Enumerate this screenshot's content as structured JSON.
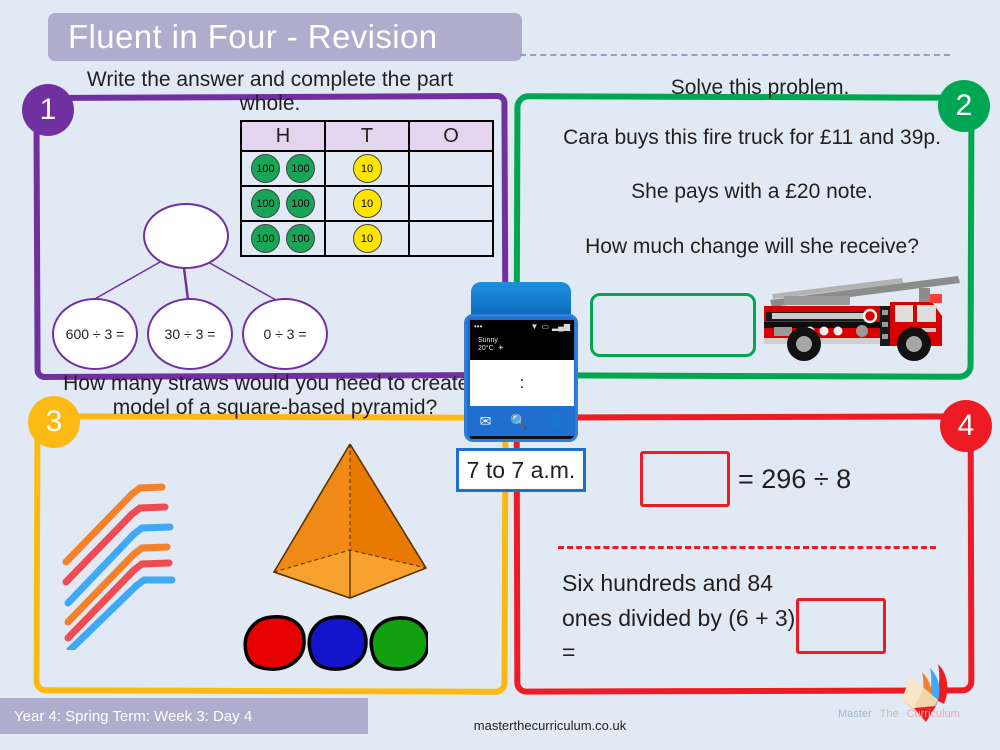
{
  "page": {
    "title": "Fluent in Four - Revision",
    "background_color": "#e1eaf4",
    "banner_color": "#afaccd"
  },
  "sections": [
    {
      "number": "1",
      "color": "#7030a0",
      "prompt": "Write the answer and complete the part whole.",
      "place_value_table": {
        "headers": [
          "H",
          "T",
          "O"
        ],
        "rows": [
          {
            "H": [
              "100",
              "100"
            ],
            "T": [
              "10"
            ],
            "O": []
          },
          {
            "H": [
              "100",
              "100"
            ],
            "T": [
              "10"
            ],
            "O": []
          },
          {
            "H": [
              "100",
              "100"
            ],
            "T": [
              "10"
            ],
            "O": []
          }
        ],
        "counter_colors": {
          "hundreds": "#18a558",
          "tens": "#ffe400"
        }
      },
      "part_whole": {
        "whole": "",
        "parts": [
          "600 ÷ 3 =",
          "30 ÷ 3 =",
          "0 ÷ 3 ="
        ]
      }
    },
    {
      "number": "2",
      "color": "#00a651",
      "prompt": "Solve this problem.",
      "lines": [
        "Cara buys this fire truck for £11 and 39p.",
        "She pays with a £20 note.",
        "How much change will she receive?"
      ],
      "answer_box": "",
      "image": "fire-truck"
    },
    {
      "number": "3",
      "color": "#fdb913",
      "prompt": "How many straws would you need to create a model of a square-based pyramid?",
      "images": [
        "drinking-straws",
        "square-based-pyramid",
        "modelling-dough-blobs"
      ],
      "straw_colors": [
        "#f5822b",
        "#ef4b53",
        "#3fa9f5",
        "#f5822b",
        "#ef4b53",
        "#3fa9f5"
      ],
      "dough_colors": [
        "#e60000",
        "#1414cc",
        "#10a010"
      ],
      "pyramid_color": "#f07c00"
    },
    {
      "number": "4",
      "color": "#ed1c24",
      "equation_1": "= 296 ÷ 8",
      "answer_box_1": "",
      "text_2": "Six hundreds and 84 ones divided by (6 + 3) =",
      "answer_box_2": ""
    }
  ],
  "phone": {
    "status_icons": [
      "dots-icon",
      "wifi-icon",
      "battery-icon",
      "signal-icon"
    ],
    "weather": "Sunny\n20°C",
    "weather_label": "Sunny",
    "weather_temp": "20°C",
    "clock": ":",
    "nav_icons": [
      "mail-icon",
      "search-icon",
      "contact-icon"
    ]
  },
  "time_box": {
    "label": "7 to 7 a.m."
  },
  "footer": {
    "banner": "Year 4: Spring Term: Week 3: Day 4",
    "url": "masterthecurriculum.co.uk",
    "logo_words": [
      "Master",
      "The",
      "Curriculum"
    ],
    "logo_colors": [
      "#9bb7d4",
      "#a8cbb0",
      "#e3a8b6"
    ]
  }
}
